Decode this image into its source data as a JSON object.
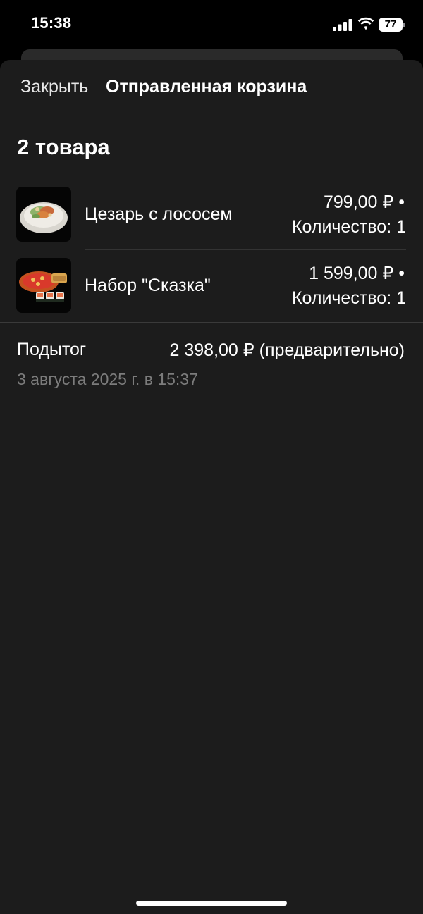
{
  "status_bar": {
    "time": "15:38",
    "battery": "77",
    "icons": [
      "signal-icon",
      "wifi-icon",
      "battery-icon"
    ]
  },
  "nav": {
    "close_label": "Закрыть",
    "title": "Отправленная корзина"
  },
  "cart": {
    "count_label": "2 товара",
    "items": [
      {
        "name": "Цезарь с лососем",
        "price": "799,00 ₽ •",
        "quantity": "Количество: 1",
        "image": "caesar-salad-image"
      },
      {
        "name": "Набор \"Сказка\"",
        "price": "1 599,00 ₽ •",
        "quantity": "Количество: 1",
        "image": "pizza-sushi-set-image"
      }
    ],
    "subtotal_label": "Подытог",
    "subtotal_value": "2 398,00 ₽ (предварительно)",
    "date": "3 августа 2025 г. в 15:37"
  },
  "colors": {
    "background": "#000000",
    "sheet": "#1c1c1c",
    "text": "#ffffff",
    "secondary_text": "#7c7c7c"
  }
}
